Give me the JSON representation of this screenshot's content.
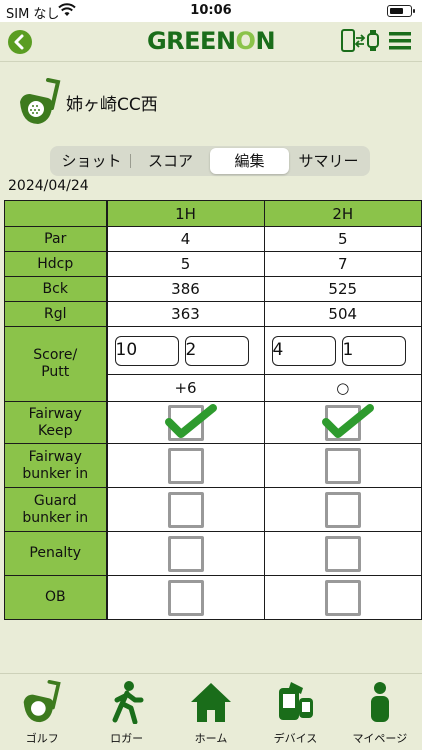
{
  "status_bar": {
    "carrier": "SIM なし",
    "time": "10:06"
  },
  "nav": {
    "logo_left": "GREEN",
    "logo_dot": "O",
    "logo_right": "N"
  },
  "course": {
    "name": "姉ヶ崎CC西"
  },
  "tabs": [
    {
      "label": "ショット",
      "active": false
    },
    {
      "label": "スコア",
      "active": false
    },
    {
      "label": "編集",
      "active": true
    },
    {
      "label": "サマリー",
      "active": false
    }
  ],
  "date": "2024/04/24",
  "holes": {
    "h1": {
      "label": "1H",
      "par": "4",
      "hdcp": "5",
      "bck": "386",
      "rgl": "363",
      "score": "10",
      "putt": "2",
      "diff": "+6",
      "fairway_keep": true
    },
    "h2": {
      "label": "2H",
      "par": "5",
      "hdcp": "7",
      "bck": "525",
      "rgl": "504",
      "score": "4",
      "putt": "1",
      "diff": "○",
      "fairway_keep": true
    }
  },
  "row_labels": {
    "par": "Par",
    "hdcp": "Hdcp",
    "bck": "Bck",
    "rgl": "Rgl",
    "score_1": "Score/",
    "score_2": "Putt",
    "fairway_1": "Fairway",
    "fairway_2": "Keep",
    "fwbunker_1": "Fairway",
    "fwbunker_2": "bunker in",
    "gbunker_1": "Guard",
    "gbunker_2": "bunker in",
    "penalty": "Penalty",
    "ob": "OB"
  },
  "bottom_tabs": [
    {
      "label": "ゴルフ",
      "icon": "golf-icon"
    },
    {
      "label": "ロガー",
      "icon": "walker-icon"
    },
    {
      "label": "ホーム",
      "icon": "home-icon"
    },
    {
      "label": "デバイス",
      "icon": "device-icon"
    },
    {
      "label": "マイページ",
      "icon": "person-icon"
    }
  ],
  "colors": {
    "accent_green": "#8bc34a",
    "logo_green": "#1a6d1a",
    "check_green": "#2e9b2e",
    "background": "#e9ecd7"
  }
}
